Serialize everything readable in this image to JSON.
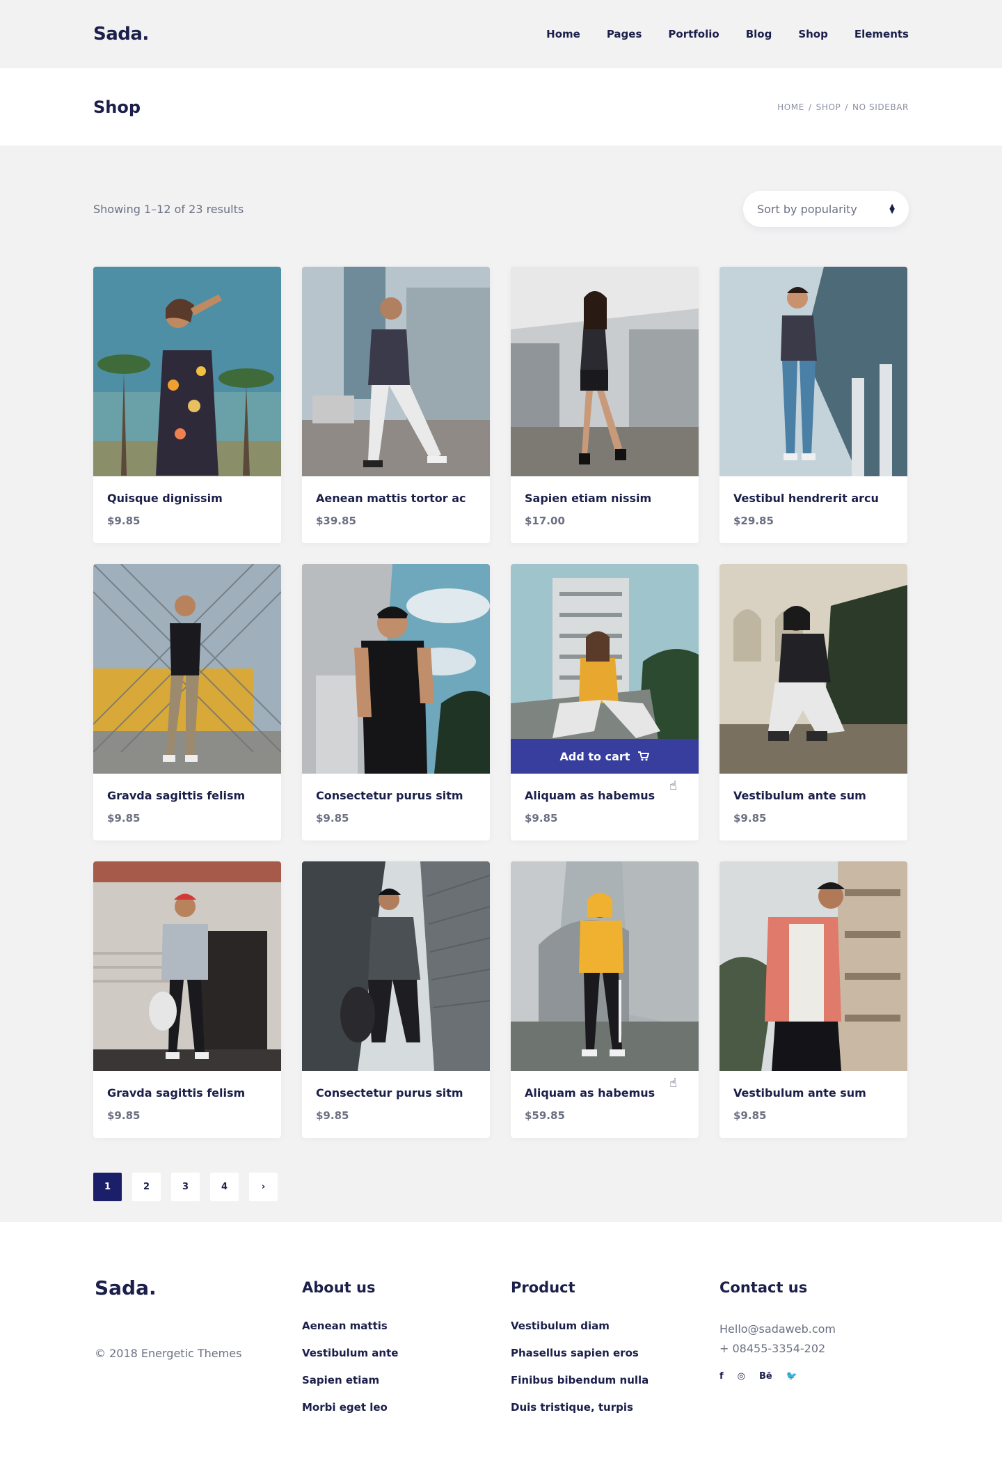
{
  "header": {
    "logo": "Sada.",
    "nav": [
      "Home",
      "Pages",
      "Portfolio",
      "Blog",
      "Shop",
      "Elements"
    ]
  },
  "titlebar": {
    "title": "Shop",
    "breadcrumb": [
      "HOME",
      "SHOP",
      "NO SIDEBAR"
    ]
  },
  "toolbar": {
    "results": "Showing 1–12 of 23 results",
    "sort_label": "Sort by popularity"
  },
  "products": [
    {
      "name": "Quisque dignissim",
      "price": "$9.85"
    },
    {
      "name": "Aenean mattis tortor ac",
      "price": "$39.85"
    },
    {
      "name": "Sapien etiam nissim",
      "price": "$17.00"
    },
    {
      "name": "Vestibul hendrerit arcu",
      "price": "$29.85"
    },
    {
      "name": "Gravda sagittis felism",
      "price": "$9.85"
    },
    {
      "name": "Consectetur purus sitm",
      "price": "$9.85"
    },
    {
      "name": "Aliquam as habemus",
      "price": "$9.85"
    },
    {
      "name": "Vestibulum ante sum",
      "price": "$9.85"
    },
    {
      "name": "Gravda sagittis felism",
      "price": "$9.85"
    },
    {
      "name": "Consectetur purus sitm",
      "price": "$9.85"
    },
    {
      "name": "Aliquam as habemus",
      "price": "$59.85"
    },
    {
      "name": "Vestibulum ante sum",
      "price": "$9.85"
    }
  ],
  "add_to_cart_label": "Add to cart",
  "pagination": [
    "1",
    "2",
    "3",
    "4",
    "›"
  ],
  "footer": {
    "logo": "Sada.",
    "copyright": "© 2018 Energetic Themes",
    "about": {
      "title": "About us",
      "links": [
        "Aenean mattis",
        "Vestibulum ante",
        "Sapien etiam",
        "Morbi eget leo"
      ]
    },
    "product": {
      "title": "Product",
      "links": [
        "Vestibulum diam",
        "Phasellus sapien eros",
        "Finibus bibendum nulla",
        "Duis tristique, turpis"
      ]
    },
    "contact": {
      "title": "Contact us",
      "email": "Hello@sadaweb.com",
      "phone": "+ 08455-3354-202"
    },
    "social": [
      "f",
      "◎",
      "Bē",
      "🐦"
    ]
  },
  "colors": {
    "accent": "#383e9e",
    "navy": "#1b1f4a",
    "muted": "#6b6f82"
  }
}
